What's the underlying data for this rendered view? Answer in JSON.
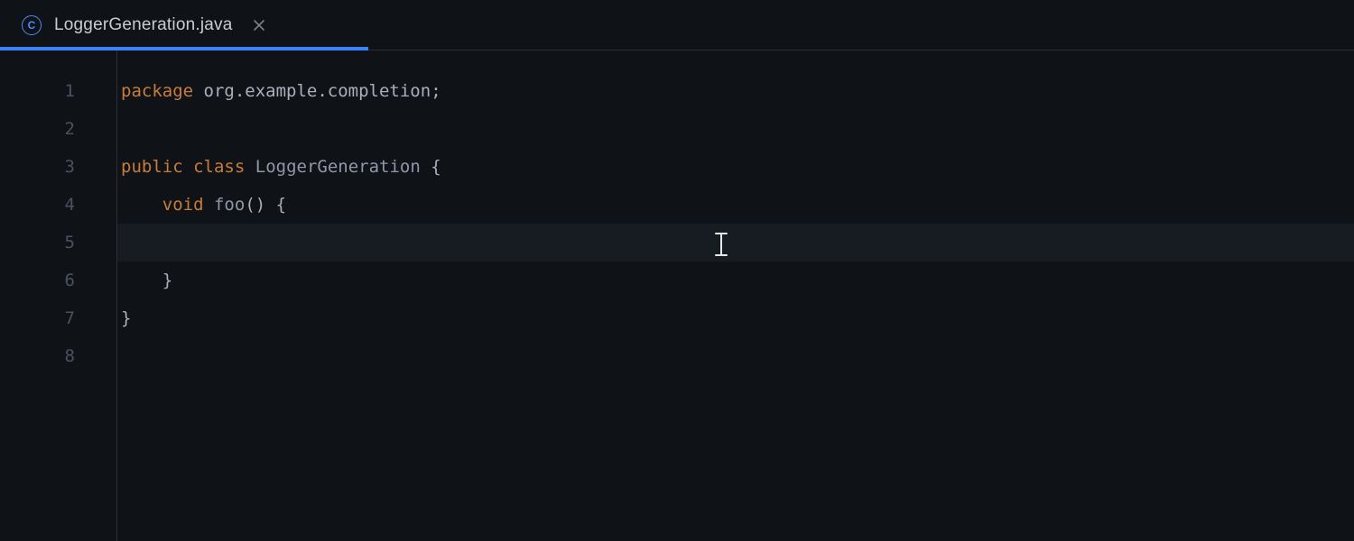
{
  "tab": {
    "icon_name": "java-class-icon",
    "icon_letter": "C",
    "title": "LoggerGeneration.java"
  },
  "gutter": {
    "lines": [
      "1",
      "2",
      "3",
      "4",
      "5",
      "6",
      "7",
      "8"
    ]
  },
  "code": {
    "highlighted_line_index": 4,
    "line1": {
      "kw_package": "package",
      "package_name": "org.example.completion",
      "semi": ";"
    },
    "line2": "",
    "line3": {
      "kw_public": "public",
      "kw_class": "class",
      "class_name": "LoggerGeneration",
      "brace": " {"
    },
    "line4": {
      "indent": "    ",
      "kw_void": "void",
      "method_name": "foo",
      "parens": "()",
      "brace": " {"
    },
    "line5": "",
    "line6": {
      "indent": "    ",
      "brace": "}"
    },
    "line7": {
      "brace": "}"
    },
    "line8": ""
  }
}
